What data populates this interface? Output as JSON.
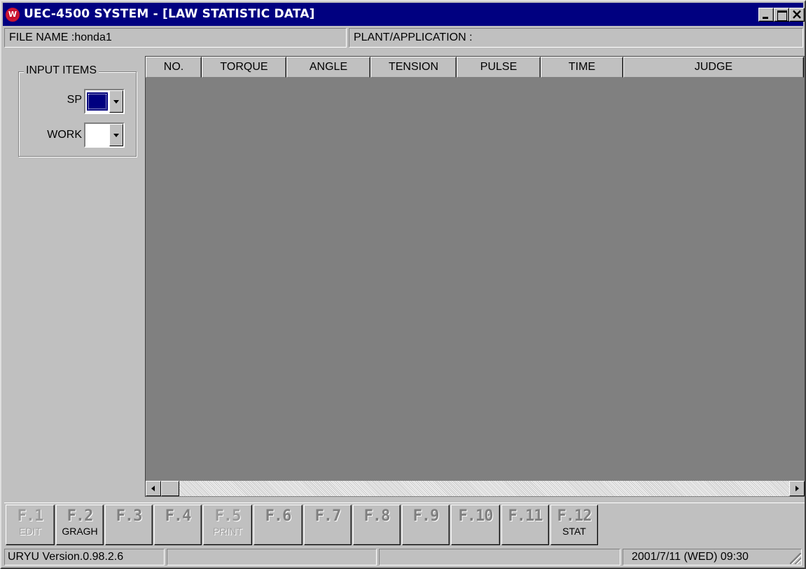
{
  "window": {
    "title": "UEC-4500 SYSTEM - [LAW STATISTIC DATA]"
  },
  "info": {
    "file_name": "FILE NAME :honda1",
    "plant_application": "PLANT/APPLICATION :"
  },
  "input_items": {
    "title": "INPUT ITEMS",
    "sp_label": "SP",
    "sp_color": "#000080",
    "work_label": "WORK",
    "work_color": "#ffffff"
  },
  "grid": {
    "columns": [
      "NO.",
      "TORQUE",
      "ANGLE",
      "TENSION",
      "PULSE",
      "TIME",
      "JUDGE"
    ],
    "rows": []
  },
  "function_keys": [
    {
      "num": "F.1",
      "label": "EDIT",
      "enabled": false
    },
    {
      "num": "F.2",
      "label": "GRAGH",
      "enabled": true
    },
    {
      "num": "F.3",
      "label": "",
      "enabled": true
    },
    {
      "num": "F.4",
      "label": "",
      "enabled": true
    },
    {
      "num": "F.5",
      "label": "PRINT",
      "enabled": false
    },
    {
      "num": "F.6",
      "label": "",
      "enabled": true
    },
    {
      "num": "F.7",
      "label": "",
      "enabled": true
    },
    {
      "num": "F.8",
      "label": "",
      "enabled": true
    },
    {
      "num": "F.9",
      "label": "",
      "enabled": true
    },
    {
      "num": "F.10",
      "label": "",
      "enabled": true
    },
    {
      "num": "F.11",
      "label": "",
      "enabled": true
    },
    {
      "num": "F.12",
      "label": "STAT",
      "enabled": true
    }
  ],
  "status": {
    "version": "URYU Version.0.98.2.6",
    "datetime": "2001/7/11 (WED) 09:30"
  },
  "colors": {
    "titlebar": "#000080",
    "face": "#c0c0c0",
    "grid_background": "#808080"
  }
}
